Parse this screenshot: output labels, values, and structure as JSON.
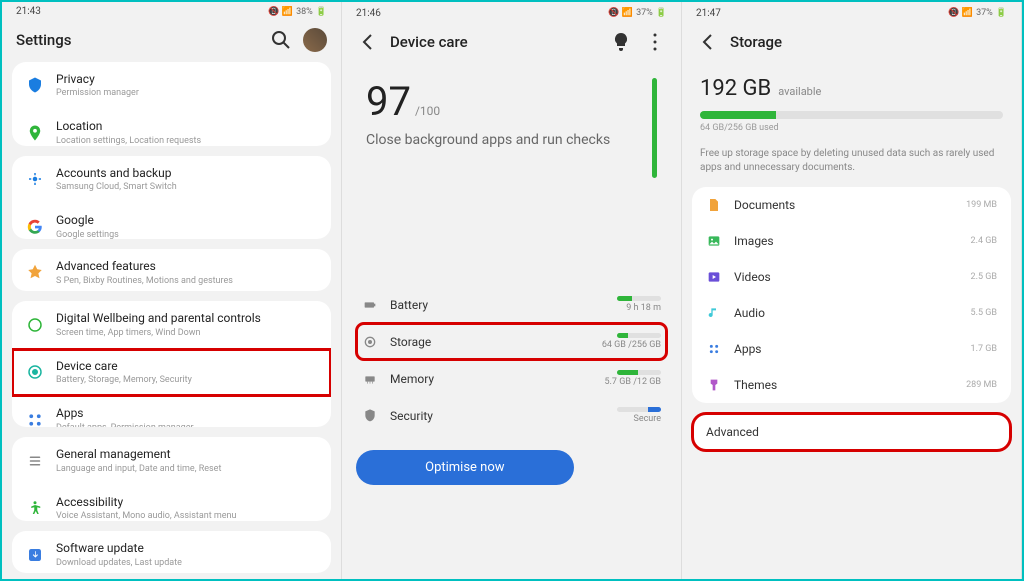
{
  "screen1": {
    "time": "21:43",
    "battery": "38%",
    "title": "Settings",
    "items": [
      {
        "title": "Privacy",
        "sub": "Permission manager",
        "icon": "privacy"
      },
      {
        "title": "Location",
        "sub": "Location settings, Location requests",
        "icon": "location"
      },
      {
        "title": "Accounts and backup",
        "sub": "Samsung Cloud, Smart Switch",
        "icon": "backup"
      },
      {
        "title": "Google",
        "sub": "Google settings",
        "icon": "google"
      },
      {
        "title": "Advanced features",
        "sub": "S Pen, Bixby Routines, Motions and gestures",
        "icon": "features"
      },
      {
        "title": "Digital Wellbeing and parental controls",
        "sub": "Screen time, App timers, Wind Down",
        "icon": "wellbeing"
      },
      {
        "title": "Device care",
        "sub": "Battery, Storage, Memory, Security",
        "icon": "devicecare"
      },
      {
        "title": "Apps",
        "sub": "Default apps, Permission manager",
        "icon": "apps"
      },
      {
        "title": "General management",
        "sub": "Language and input, Date and time, Reset",
        "icon": "general"
      },
      {
        "title": "Accessibility",
        "sub": "Voice Assistant, Mono audio, Assistant menu",
        "icon": "accessibility"
      },
      {
        "title": "Software update",
        "sub": "Download updates, Last update",
        "icon": "update"
      }
    ]
  },
  "screen2": {
    "time": "21:46",
    "battery": "37%",
    "title": "Device care",
    "score": "97",
    "scoreMax": "/100",
    "desc": "Close background apps and run checks",
    "items": [
      {
        "label": "Battery",
        "text": "9 h 18 m",
        "fill": 35
      },
      {
        "label": "Storage",
        "text": "64 GB /256 GB",
        "fill": 25
      },
      {
        "label": "Memory",
        "text": "5.7 GB /12 GB",
        "fill": 48
      },
      {
        "label": "Security",
        "text": "Secure",
        "fill": 0,
        "blue": true
      }
    ],
    "optimize": "Optimise now"
  },
  "screen3": {
    "time": "21:47",
    "battery": "37%",
    "title": "Storage",
    "avail": "192 GB",
    "availLabel": "available",
    "used": "64 GB/256 GB used",
    "desc": "Free up storage space by deleting unused data such as rarely used apps and unnecessary documents.",
    "items": [
      {
        "label": "Documents",
        "size": "199 MB",
        "color": "#f1a33b"
      },
      {
        "label": "Images",
        "size": "2.4 GB",
        "color": "#38b85a"
      },
      {
        "label": "Videos",
        "size": "2.5 GB",
        "color": "#6a4fd8"
      },
      {
        "label": "Audio",
        "size": "5.5 GB",
        "color": "#3fc9d8"
      },
      {
        "label": "Apps",
        "size": "1.7 GB",
        "color": "#3a7de0"
      },
      {
        "label": "Themes",
        "size": "289 MB",
        "color": "#b157c9"
      }
    ],
    "advanced": "Advanced"
  }
}
